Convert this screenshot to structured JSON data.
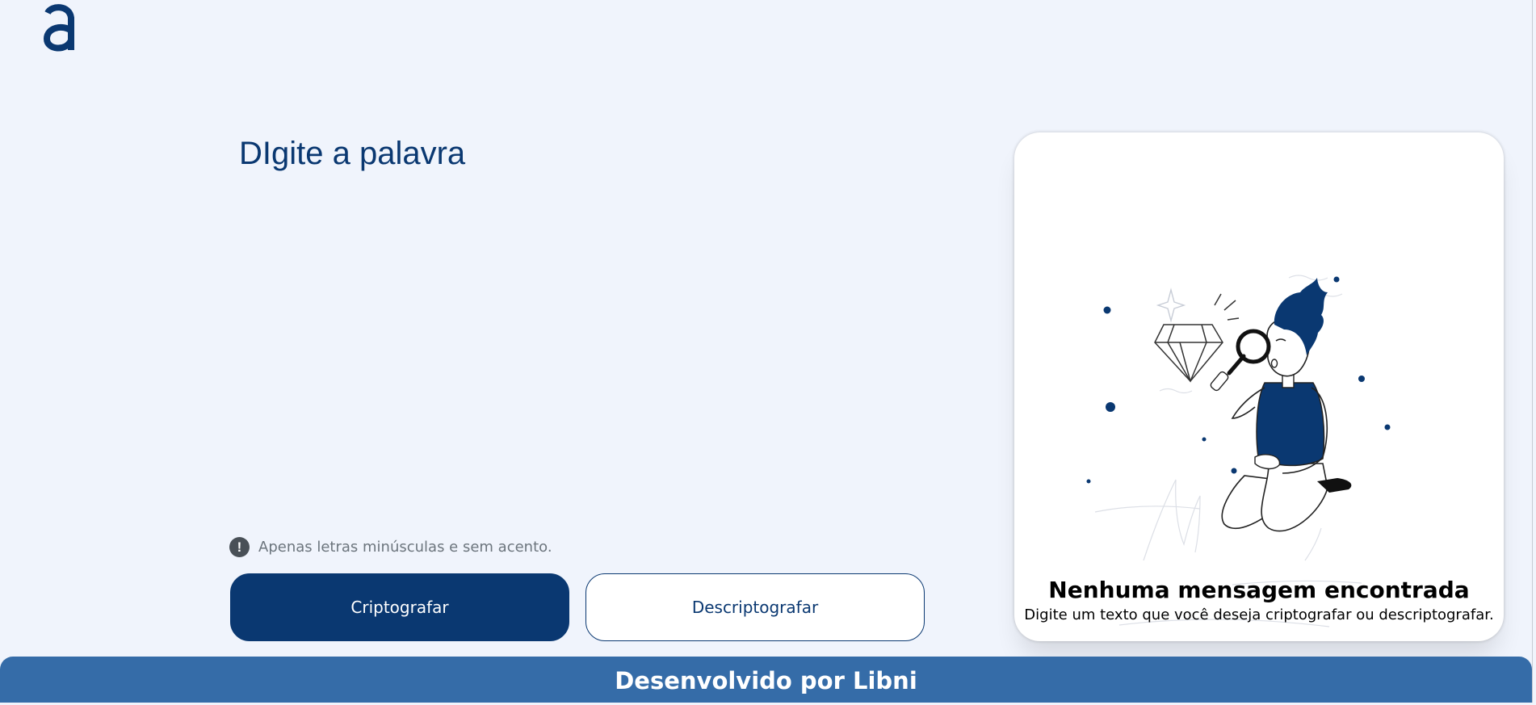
{
  "logo": {
    "alt": "Alura logo",
    "icon": "alura-logo",
    "color": "#0a3871"
  },
  "input": {
    "placeholder": "DIgite a palavra",
    "value": ""
  },
  "warning": {
    "icon": "exclamation-circle-icon",
    "text": "Apenas letras minúsculas e sem acento."
  },
  "buttons": {
    "encrypt_label": "Criptografar",
    "decrypt_label": "Descriptografar"
  },
  "output": {
    "illustration": "boy-with-magnifying-glass",
    "title": "Nenhuma mensagem encontrada",
    "subtitle": "Digite um texto que você deseja criptografar ou descriptografar."
  },
  "footer": {
    "text": "Desenvolvido por Libni"
  },
  "colors": {
    "background": "#f0f4fc",
    "primary": "#0a3871",
    "footer": "#356ca8",
    "card": "#ffffff",
    "muted": "#6c757d"
  }
}
